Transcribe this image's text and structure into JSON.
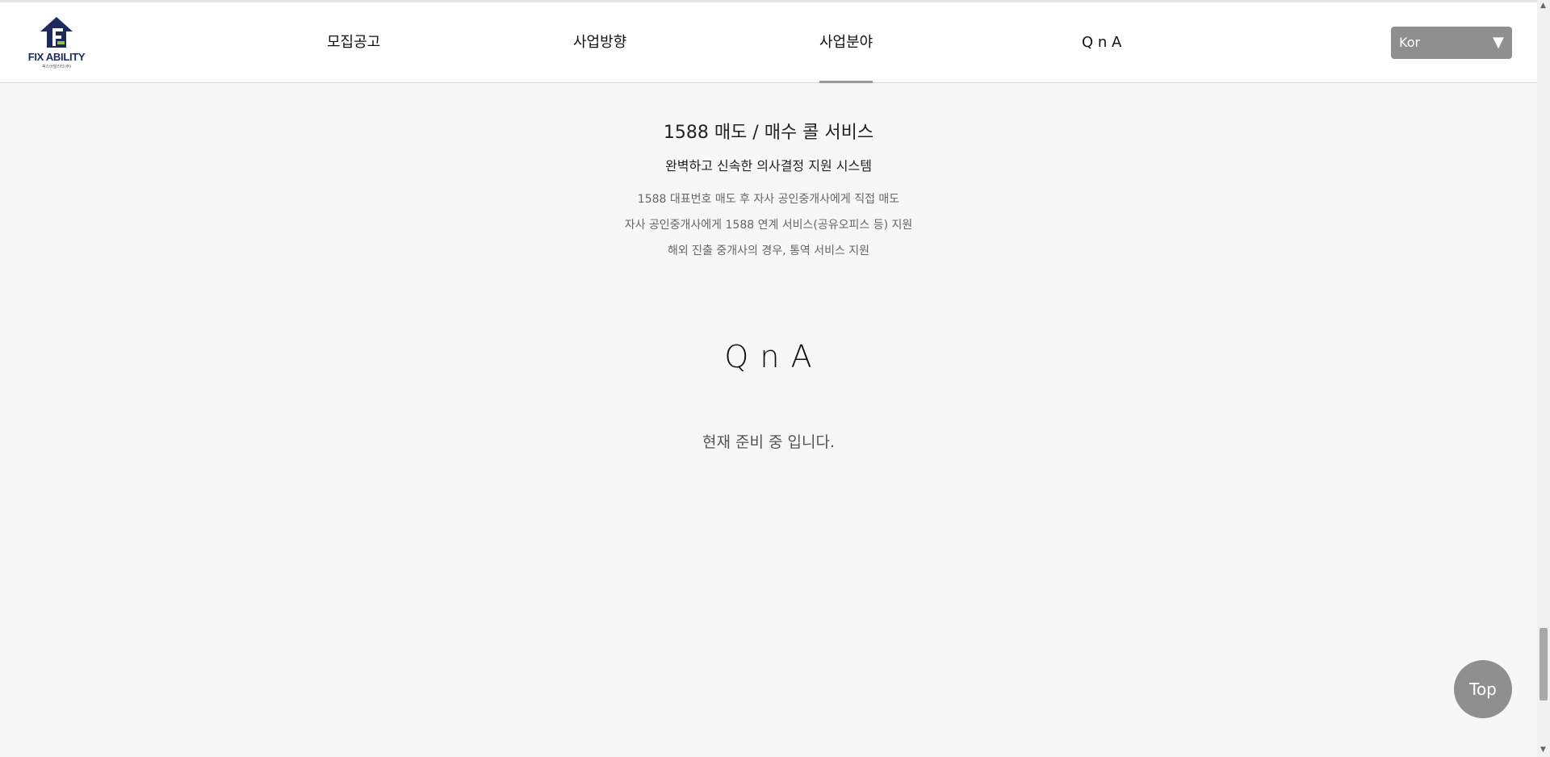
{
  "brand": {
    "name": "FIX ABILITY",
    "tagline": "픽스어빌리티(주)"
  },
  "nav": {
    "items": [
      {
        "label": "모집공고"
      },
      {
        "label": "사업방향"
      },
      {
        "label": "사업분야",
        "active": true
      },
      {
        "label": "Q n A"
      }
    ]
  },
  "language": {
    "selected": "Kor",
    "arrow_icon": "triangle-down"
  },
  "service": {
    "title": "1588 매도 / 매수 콜 서비스",
    "subtitle": "완벽하고 신속한 의사결정 지원 시스템",
    "lines": [
      "1588 대표번호 매도 후 자사 공인중개사에게 직접 매도",
      "자사 공인중개사에게 1588 연계 서비스(공유오피스 등) 지원",
      "해외 진출 중개사의 경우, 통역 서비스 지원"
    ]
  },
  "qna": {
    "title": "Q n A",
    "message": "현재 준비 중 입니다."
  },
  "top_button": {
    "label": "Top"
  },
  "colors": {
    "brand_navy": "#1f2a5c",
    "brand_green": "#8dc63f",
    "button_gray": "#8f8f8f",
    "background": "#f7f7f7"
  }
}
